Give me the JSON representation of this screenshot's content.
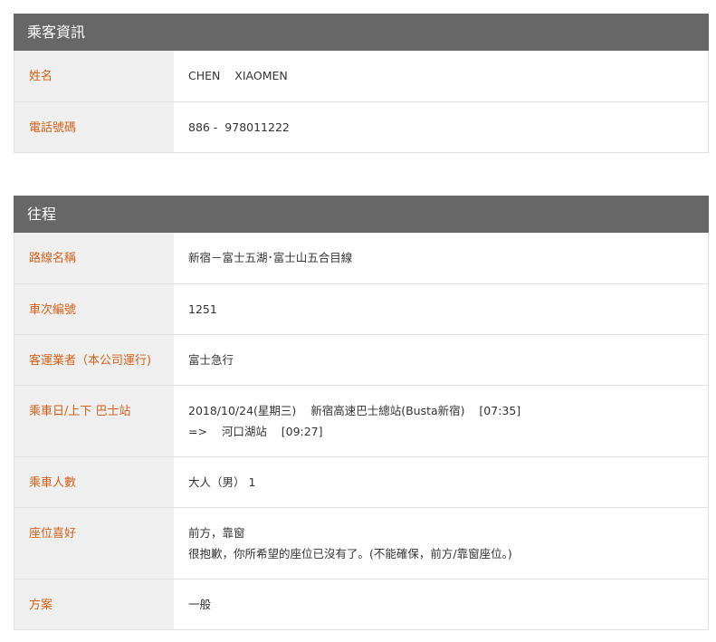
{
  "passenger": {
    "title": "乘客資訊",
    "rows": [
      {
        "label": "姓名",
        "value": "CHEN    XIAOMEN"
      },
      {
        "label": "電話號碼",
        "value": "886 -  978011222"
      }
    ]
  },
  "outbound": {
    "title": "往程",
    "rows": [
      {
        "label": "路線名稱",
        "value": "新宿－富士五湖･富士山五合目線"
      },
      {
        "label": "車次編號",
        "value": "1251"
      },
      {
        "label": "客運業者（本公司運行)",
        "value": "富士急行"
      },
      {
        "label": "乘車日/上下 巴士站",
        "value_lines": [
          "2018/10/24(星期三)    新宿高速巴士總站(Busta新宿)    [07:35]",
          "=>    河口湖站    [09:27]"
        ]
      },
      {
        "label": "乘車人數",
        "value": "大人（男） 1"
      },
      {
        "label": "座位喜好",
        "value_lines": [
          "前方，靠窗",
          "很抱歉，你所希望的座位已沒有了。(不能確保，前方/靠窗座位。)"
        ]
      },
      {
        "label": "方案",
        "value": "一般"
      }
    ]
  }
}
